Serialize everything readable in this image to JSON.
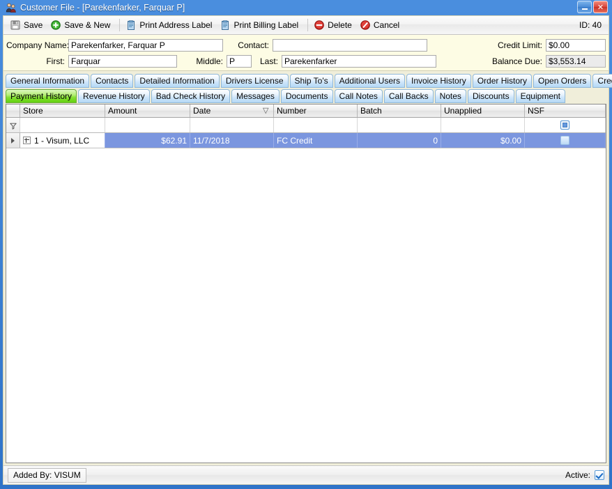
{
  "window": {
    "title": "Customer File - [Parekenfarker, Farquar P]",
    "icon": "customer-people-icon",
    "minimize_label": "_",
    "close_label": "✕"
  },
  "toolbar": {
    "buttons": [
      {
        "label": "Save",
        "icon": "floppy-disk-icon"
      },
      {
        "label": "Save & New",
        "icon": "green-plus-circle-icon"
      },
      {
        "label": "Print Address Label",
        "icon": "print-document-icon"
      },
      {
        "label": "Print Billing Label",
        "icon": "print-document-icon"
      },
      {
        "label": "Delete",
        "icon": "red-minus-circle-icon"
      },
      {
        "label": "Cancel",
        "icon": "red-slash-circle-icon"
      }
    ],
    "id_text": "ID: 40"
  },
  "header_fields": {
    "company_name_label": "Company Name:",
    "company_name_value": "Parekenfarker, Farquar P",
    "contact_label": "Contact:",
    "contact_value": "",
    "first_label": "First:",
    "first_value": "Farquar",
    "middle_label": "Middle:",
    "middle_value": "P",
    "last_label": "Last:",
    "last_value": "Parekenfarker",
    "credit_limit_label": "Credit Limit:",
    "credit_limit_value": "$0.00",
    "balance_due_label": "Balance Due:",
    "balance_due_value": "$3,553.14"
  },
  "tabs_row1": [
    {
      "label": "General Information",
      "active": false
    },
    {
      "label": "Contacts",
      "active": false
    },
    {
      "label": "Detailed Information",
      "active": false
    },
    {
      "label": "Drivers License",
      "active": false
    },
    {
      "label": "Ship To's",
      "active": false
    },
    {
      "label": "Additional Users",
      "active": false
    },
    {
      "label": "Invoice History",
      "active": false
    },
    {
      "label": "Order History",
      "active": false
    },
    {
      "label": "Open Orders",
      "active": false
    },
    {
      "label": "Credit History",
      "active": false
    }
  ],
  "tabs_row2": [
    {
      "label": "Payment History",
      "active": true
    },
    {
      "label": "Revenue History",
      "active": false
    },
    {
      "label": "Bad Check History",
      "active": false
    },
    {
      "label": "Messages",
      "active": false
    },
    {
      "label": "Documents",
      "active": false
    },
    {
      "label": "Call Notes",
      "active": false
    },
    {
      "label": "Call Backs",
      "active": false
    },
    {
      "label": "Notes",
      "active": false
    },
    {
      "label": "Discounts",
      "active": false
    },
    {
      "label": "Equipment",
      "active": false
    }
  ],
  "grid": {
    "columns": [
      {
        "label": "Store",
        "sorted": ""
      },
      {
        "label": "Amount",
        "sorted": ""
      },
      {
        "label": "Date",
        "sorted": "descending"
      },
      {
        "label": "Number",
        "sorted": ""
      },
      {
        "label": "Batch",
        "sorted": ""
      },
      {
        "label": "Unapplied",
        "sorted": ""
      },
      {
        "label": "NSF",
        "sorted": ""
      }
    ],
    "filter_row": {
      "store": "",
      "amount": "",
      "date": "",
      "number": "",
      "batch": "",
      "unapplied": "",
      "nsf_state": "indeterminate"
    },
    "rows": [
      {
        "store": "1 - Visum, LLC",
        "amount": "$62.91",
        "date": "11/7/2018",
        "number": "FC Credit",
        "batch": "0",
        "unapplied": "$0.00",
        "nsf_checked": false,
        "selected": true
      }
    ]
  },
  "statusbar": {
    "added_by": "Added By: VISUM",
    "active_label": "Active:",
    "active_checked": true
  },
  "colors": {
    "window_frame": "#3c7fd0",
    "field_panel": "#fdfce4",
    "active_tab": "#86e034",
    "inactive_tab": "#cfe6fa",
    "row_selected": "#7b96df",
    "accent_red": "#d9453a"
  }
}
